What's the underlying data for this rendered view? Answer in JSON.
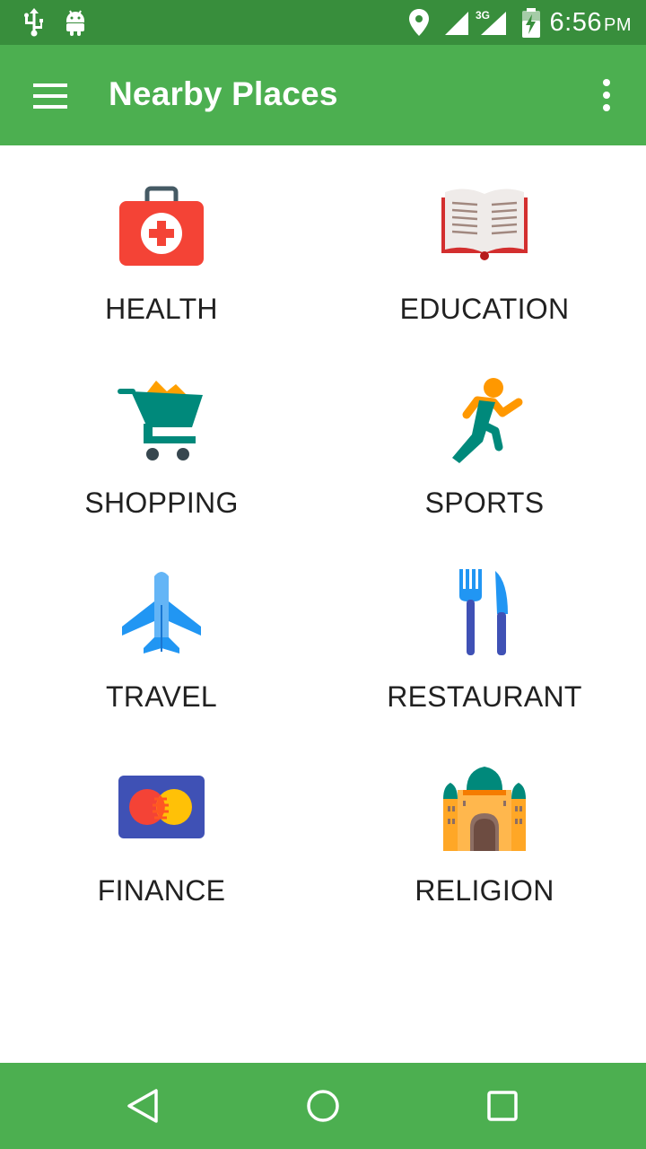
{
  "status_bar": {
    "time": "6:56",
    "ampm": "PM",
    "network": "3G",
    "icons": [
      "usb-icon",
      "android-icon",
      "location-icon",
      "wifi-signal-icon",
      "cell-signal-icon",
      "battery-charging-icon"
    ]
  },
  "app_bar": {
    "title": "Nearby Places",
    "menu_icon": "hamburger-menu-icon",
    "overflow_icon": "more-vert-icon"
  },
  "categories": [
    {
      "label": "HEALTH",
      "icon": "first-aid-kit-icon"
    },
    {
      "label": "EDUCATION",
      "icon": "open-book-icon"
    },
    {
      "label": "SHOPPING",
      "icon": "shopping-cart-icon"
    },
    {
      "label": "SPORTS",
      "icon": "running-person-icon"
    },
    {
      "label": "TRAVEL",
      "icon": "airplane-icon"
    },
    {
      "label": "RESTAURANT",
      "icon": "fork-knife-icon"
    },
    {
      "label": "FINANCE",
      "icon": "credit-card-icon"
    },
    {
      "label": "RELIGION",
      "icon": "temple-icon"
    }
  ],
  "nav_bar": {
    "icons": [
      "back-icon",
      "home-icon",
      "recents-icon"
    ]
  },
  "colors": {
    "status_bar": "#388E3C",
    "app_bar": "#4CAF50",
    "nav_bar": "#4CAF50",
    "label_text": "#212121"
  }
}
